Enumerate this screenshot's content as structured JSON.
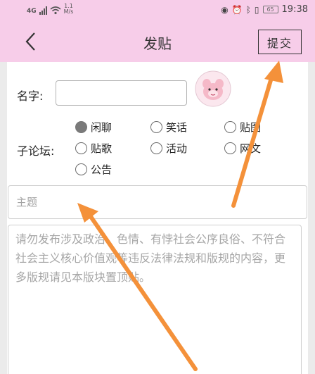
{
  "status_bar": {
    "network": "4G",
    "speed_value": "1.1",
    "speed_unit": "M/s",
    "icons": [
      "eye-icon",
      "alarm-icon",
      "bluetooth-icon",
      "vibrate-icon"
    ],
    "battery": "65",
    "time": "19:38"
  },
  "header": {
    "back_icon": "chevron-left-icon",
    "title": "发贴",
    "submit_label": "提交"
  },
  "form": {
    "name_label": "名字:",
    "name_value": "",
    "forum_label": "子论坛:",
    "forum_options": [
      {
        "label": "闲聊",
        "checked": true
      },
      {
        "label": "笑话",
        "checked": false
      },
      {
        "label": "贴图",
        "checked": false
      },
      {
        "label": "贴歌",
        "checked": false
      },
      {
        "label": "活动",
        "checked": false
      },
      {
        "label": "网文",
        "checked": false
      },
      {
        "label": "公告",
        "checked": false
      }
    ],
    "subject_placeholder": "主题",
    "body_placeholder": "请勿发布涉及政治、色情、有悖社会公序良俗、不符合社会主义核心价值观等违反法律法规和版规的内容，更多版规请见本版块置顶贴。"
  },
  "colors": {
    "header_bg": "#f7cde9",
    "annotation_arrow": "#f4913a"
  }
}
